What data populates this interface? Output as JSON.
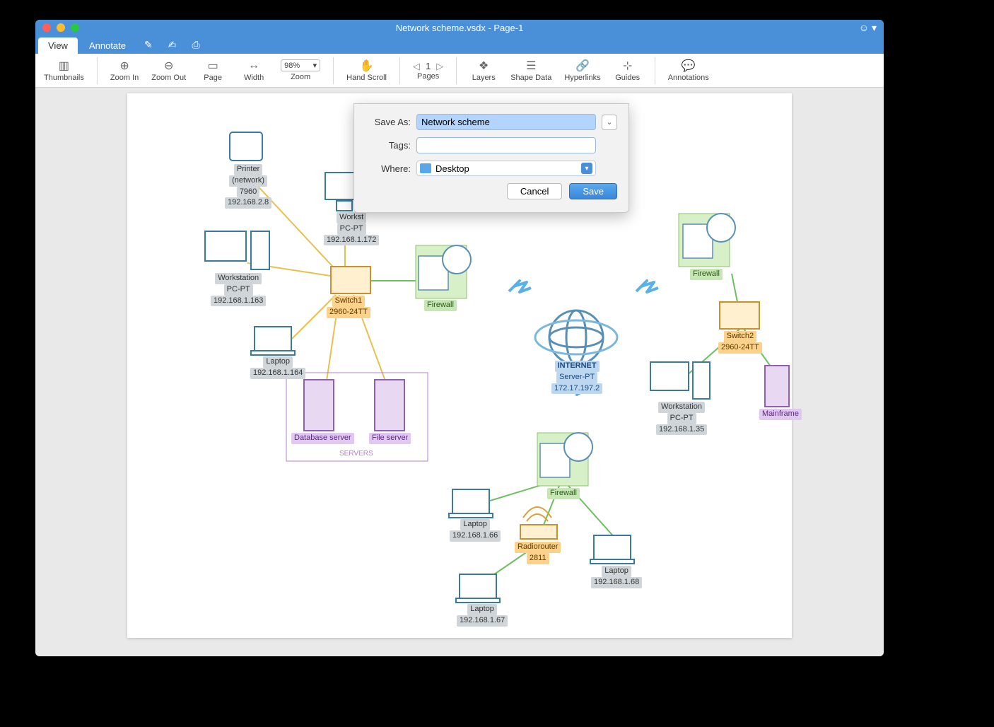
{
  "window": {
    "title": "Network scheme.vsdx - Page-1"
  },
  "tabs": {
    "view": "View",
    "annotate": "Annotate"
  },
  "toolbar": {
    "thumbnails": "Thumbnails",
    "zoomIn": "Zoom In",
    "zoomOut": "Zoom Out",
    "page": "Page",
    "width": "Width",
    "zoomValue": "98%",
    "zoom": "Zoom",
    "handScroll": "Hand Scroll",
    "pageNum": "1",
    "pages": "Pages",
    "layers": "Layers",
    "shapeData": "Shape Data",
    "hyperlinks": "Hyperlinks",
    "guides": "Guides",
    "annotations": "Annotations"
  },
  "dialog": {
    "saveAsLabel": "Save As:",
    "saveAsValue": "Network scheme",
    "tagsLabel": "Tags:",
    "whereLabel": "Where:",
    "whereValue": "Desktop",
    "cancel": "Cancel",
    "save": "Save"
  },
  "nodes": {
    "printer": {
      "l1": "Printer",
      "l2": "(network)",
      "l3": "7960",
      "l4": "192.168.2.8"
    },
    "ws1": {
      "l1": "Workstation",
      "l2": "PC-PT",
      "l3": "192.168.1.163"
    },
    "ws2": {
      "l1": "Workst",
      "l2": "PC-PT",
      "l3": "192.168.1.172"
    },
    "laptop1": {
      "l1": "Laptop",
      "l2": "192.168.1.164"
    },
    "switch1": {
      "l1": "Switch1",
      "l2": "2960-24TT"
    },
    "fw1": {
      "l1": "Firewall"
    },
    "dbserver": {
      "l1": "Database server"
    },
    "fileserver": {
      "l1": "File server"
    },
    "serversGroup": "SERVERS",
    "internet": {
      "l1": "INTERNET",
      "l2": "Server-PT",
      "l3": "172.17.197.2"
    },
    "fw2": {
      "l1": "Firewall"
    },
    "switch2": {
      "l1": "Switch2",
      "l2": "2960-24TT"
    },
    "ws3": {
      "l1": "Workstation",
      "l2": "PC-PT",
      "l3": "192.168.1.35"
    },
    "mainframe": {
      "l1": "Mainframe"
    },
    "fw3": {
      "l1": "Firewall"
    },
    "laptop2": {
      "l1": "Laptop",
      "l2": "192.168.1.66"
    },
    "radiorouter": {
      "l1": "Radiorouter",
      "l2": "2811"
    },
    "laptop3": {
      "l1": "Laptop",
      "l2": "192.168.1.68"
    },
    "laptop4": {
      "l1": "Laptop",
      "l2": "192.168.1.67"
    }
  }
}
